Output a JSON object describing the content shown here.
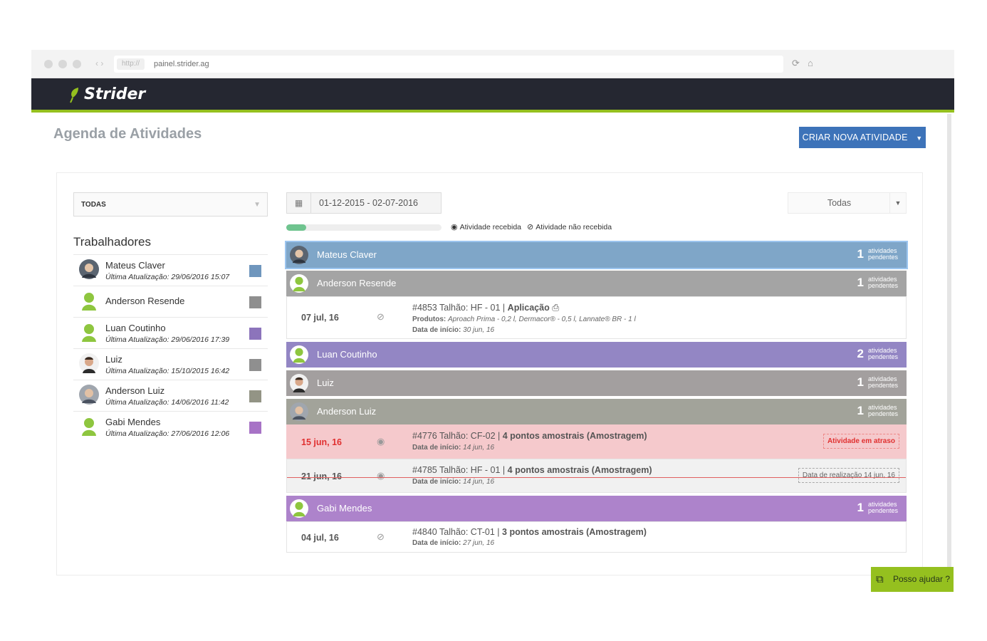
{
  "browser": {
    "protocol": "http://",
    "url": "painel.strider.ag"
  },
  "app": {
    "brand": "Strider"
  },
  "page": {
    "title": "Agenda de Atividades",
    "create_button": "CRIAR NOVA ATIVIDADE"
  },
  "filters": {
    "team": "TODAS",
    "date_range": "01-12-2015 - 02-07-2016",
    "status": "Todas",
    "progress_fraction": 0.13,
    "legend_received": "Atividade recebida",
    "legend_not_received": "Atividade não recebida"
  },
  "workers": {
    "title": "Trabalhadores",
    "items": [
      {
        "name": "Mateus Claver",
        "update": "Última Atualização: 29/06/2016 15:07",
        "color": "#6f96bd",
        "avatar": "photo"
      },
      {
        "name": "Anderson Resende",
        "update": "",
        "color": "#8f8f8f",
        "avatar": "generic"
      },
      {
        "name": "Luan Coutinho",
        "update": "Última Atualização: 29/06/2016 17:39",
        "color": "#8c74bb",
        "avatar": "generic"
      },
      {
        "name": "Luiz",
        "update": "Última Atualização: 15/10/2015 16:42",
        "color": "#8f8f8f",
        "avatar": "photo"
      },
      {
        "name": "Anderson Luiz",
        "update": "Última Atualização: 14/06/2016 11:42",
        "color": "#939485",
        "avatar": "photo"
      },
      {
        "name": "Gabi Mendes",
        "update": "Última Atualização: 27/06/2016 12:06",
        "color": "#a773c6",
        "avatar": "generic"
      }
    ]
  },
  "groups": [
    {
      "name": "Mateus Claver",
      "count": "1",
      "label1": "atividades",
      "label2": "pendentes",
      "color": "#7fa6c8"
    },
    {
      "name": "Anderson Resende",
      "count": "1",
      "label1": "atividades",
      "label2": "pendentes",
      "color": "#a4a4a4"
    },
    {
      "name": "Luan Coutinho",
      "count": "2",
      "label1": "atividades",
      "label2": "pendentes",
      "color": "#9386c4"
    },
    {
      "name": "Luiz",
      "count": "1",
      "label1": "atividades",
      "label2": "pendentes",
      "color": "#a39f9f"
    },
    {
      "name": "Anderson Luiz",
      "count": "1",
      "label1": "atividades",
      "label2": "pendentes",
      "color": "#a2a39a"
    },
    {
      "name": "Gabi Mendes",
      "count": "1",
      "label1": "atividades",
      "label2": "pendentes",
      "color": "#ad83cb"
    }
  ],
  "tasks": {
    "t4853": {
      "date": "07 jul, 16",
      "title": "#4853 Talhão: HF - 01 |",
      "type": "Aplicação",
      "products_label": "Produtos:",
      "products": "Aproach Prima - 0,2 l, Dermacor® - 0,5 l, Lannate® BR - 1 l",
      "start_label": "Data de início:",
      "start": "30 jun, 16"
    },
    "t4776": {
      "date": "15 jun, 16",
      "title": "#4776 Talhão: CF-02 |",
      "type": "4 pontos amostrais (Amostragem)",
      "start_label": "Data de início:",
      "start": "14 jun, 16",
      "badge": "Atividade em atraso"
    },
    "t4785": {
      "date": "21 jun, 16",
      "title": "#4785 Talhão: HF - 01 |",
      "type": "4 pontos amostrais (Amostragem)",
      "start_label": "Data de início:",
      "start": "14 jun, 16",
      "badge": "Data de realização 14 jun, 16"
    },
    "t4840": {
      "date": "04 jul, 16",
      "title": "#4840 Talhão: CT-01 |",
      "type": "3 pontos amostrais (Amostragem)",
      "start_label": "Data de início:",
      "start": "27 jun, 16"
    }
  },
  "help": {
    "label": "Posso ajudar ?"
  }
}
